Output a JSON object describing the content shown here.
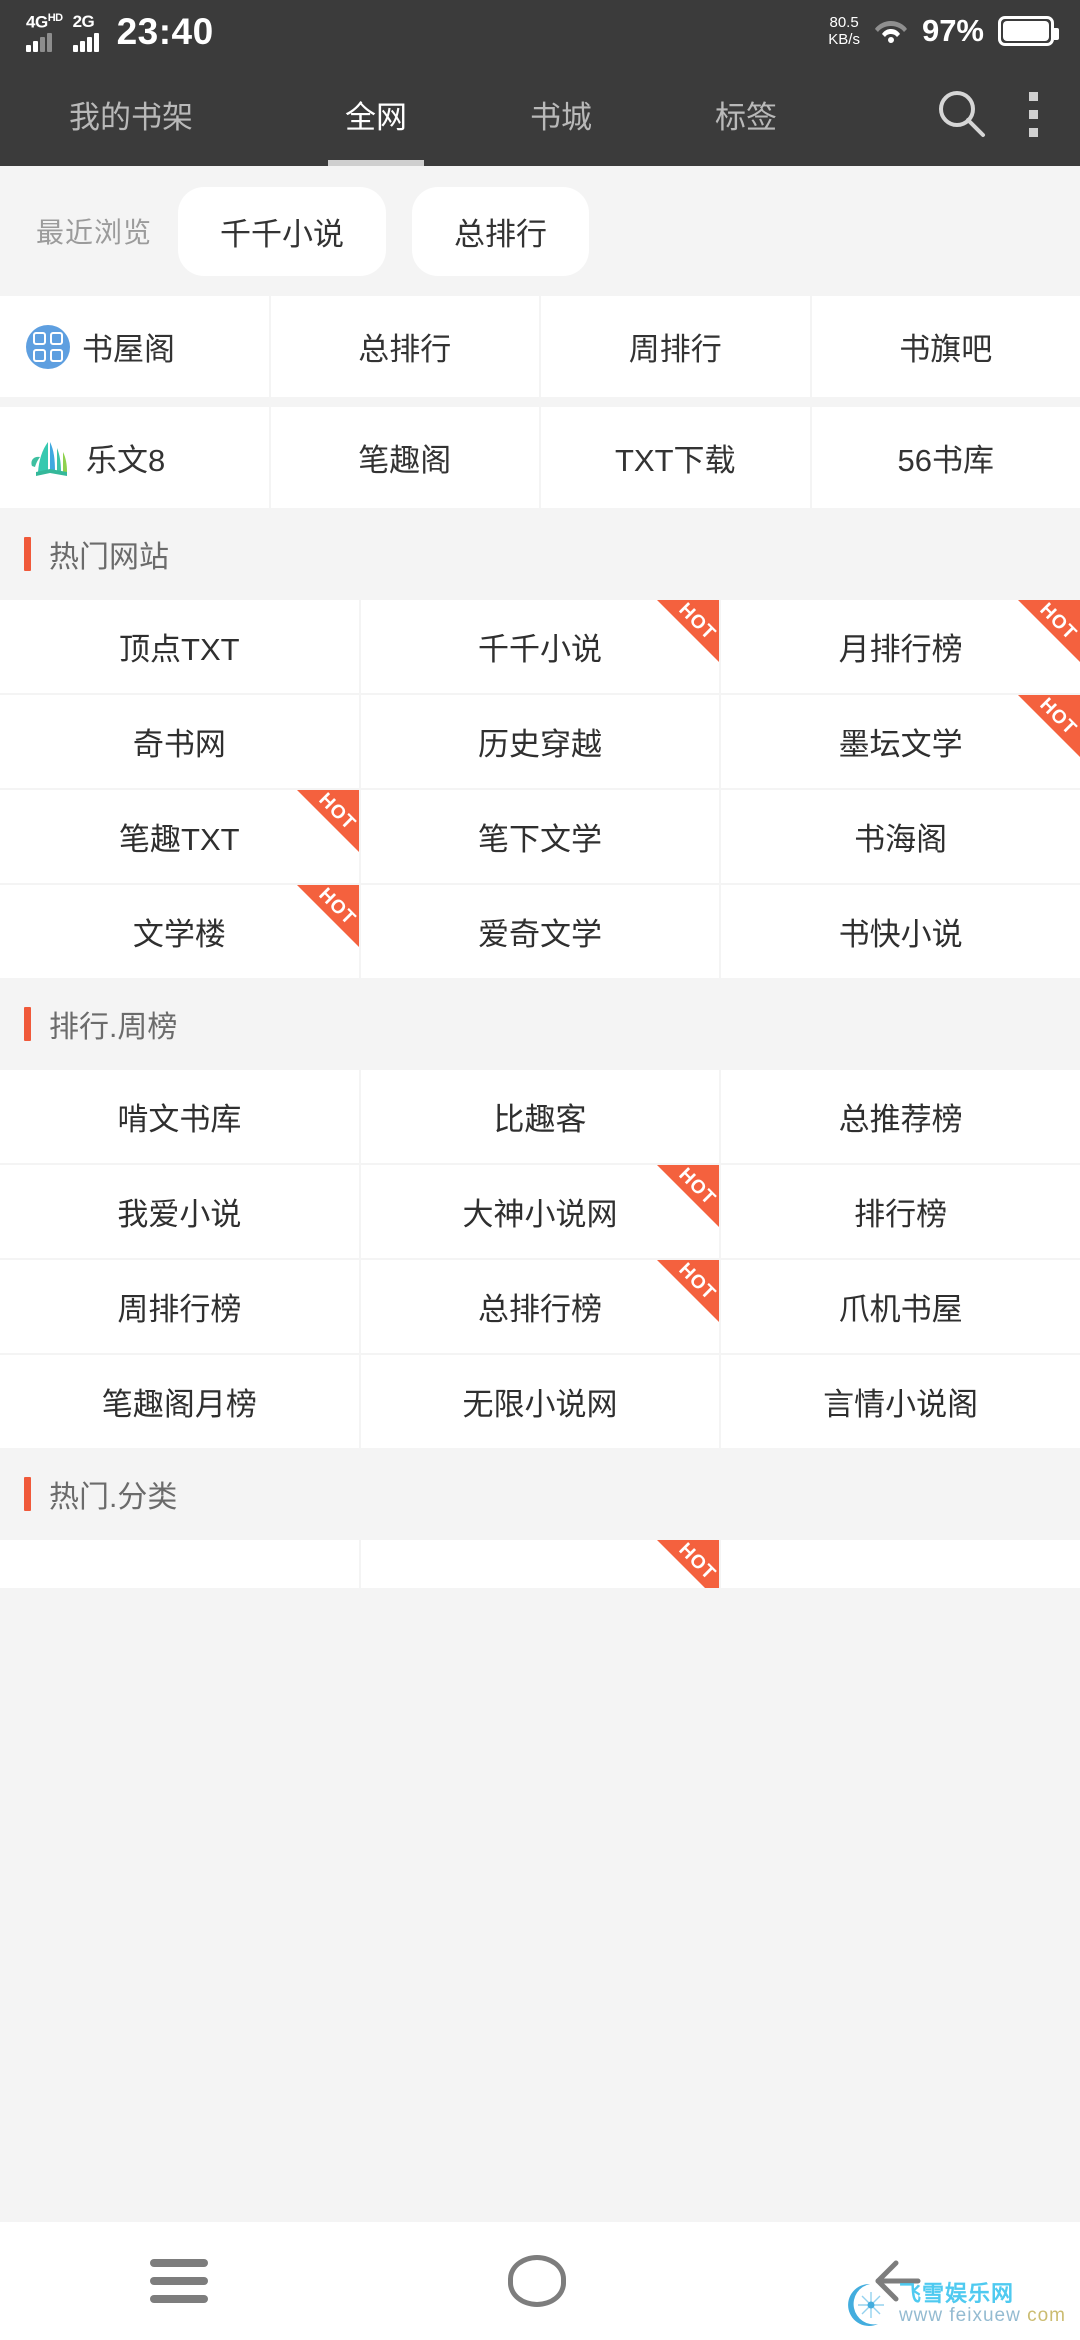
{
  "status_bar": {
    "signal_primary": "4G",
    "signal_primary_sup": "HD",
    "signal_secondary": "2G",
    "time": "23:40",
    "net_speed_value": "80.5",
    "net_speed_unit": "KB/s",
    "wifi_icon": "wifi-icon",
    "battery_percent": "97%"
  },
  "appbar": {
    "tabs": [
      {
        "label": "我的书架",
        "active": false
      },
      {
        "label": "全网",
        "active": true
      },
      {
        "label": "书城",
        "active": false
      },
      {
        "label": "标签",
        "active": false
      }
    ],
    "search_icon": "search-icon",
    "overflow_icon": "more-vertical-icon"
  },
  "recent": {
    "label": "最近浏览",
    "items": [
      "千千小说",
      "总排行"
    ]
  },
  "quick_grid": [
    [
      {
        "label": "书屋阁",
        "icon": "grid-app-icon"
      },
      {
        "label": "总排行",
        "icon": null
      },
      {
        "label": "周排行",
        "icon": null
      },
      {
        "label": "书旗吧",
        "icon": null
      }
    ],
    [
      {
        "label": "乐文8",
        "icon": "open-book-icon"
      },
      {
        "label": "笔趣阁",
        "icon": null
      },
      {
        "label": "TXT下载",
        "icon": null
      },
      {
        "label": "56书库",
        "icon": null
      }
    ]
  ],
  "sections": [
    {
      "title": "热门网站",
      "rows": [
        [
          {
            "label": "顶点TXT",
            "hot": false
          },
          {
            "label": "千千小说",
            "hot": true
          },
          {
            "label": "月排行榜",
            "hot": true
          }
        ],
        [
          {
            "label": "奇书网",
            "hot": false
          },
          {
            "label": "历史穿越",
            "hot": false
          },
          {
            "label": "墨坛文学",
            "hot": true
          }
        ],
        [
          {
            "label": "笔趣TXT",
            "hot": true
          },
          {
            "label": "笔下文学",
            "hot": false
          },
          {
            "label": "书海阁",
            "hot": false
          }
        ],
        [
          {
            "label": "文学楼",
            "hot": true
          },
          {
            "label": "爱奇文学",
            "hot": false
          },
          {
            "label": "书快小说",
            "hot": false
          }
        ]
      ]
    },
    {
      "title": "排行.周榜",
      "rows": [
        [
          {
            "label": "啃文书库",
            "hot": false
          },
          {
            "label": "比趣客",
            "hot": false
          },
          {
            "label": "总推荐榜",
            "hot": false
          }
        ],
        [
          {
            "label": "我爱小说",
            "hot": false
          },
          {
            "label": "大神小说网",
            "hot": true
          },
          {
            "label": "排行榜",
            "hot": false
          }
        ],
        [
          {
            "label": "周排行榜",
            "hot": false
          },
          {
            "label": "总排行榜",
            "hot": true
          },
          {
            "label": "爪机书屋",
            "hot": false
          }
        ],
        [
          {
            "label": "笔趣阁月榜",
            "hot": false
          },
          {
            "label": "无限小说网",
            "hot": false
          },
          {
            "label": "言情小说阁",
            "hot": false
          }
        ]
      ]
    },
    {
      "title": "热门.分类",
      "rows": [
        [
          {
            "label": "",
            "hot": false
          },
          {
            "label": "",
            "hot": true
          },
          {
            "label": "",
            "hot": false
          }
        ]
      ]
    }
  ],
  "hot_badge_text": "HOT",
  "navbar": {
    "recents_icon": "menu-recents-icon",
    "home_icon": "home-circle-icon",
    "back_icon": "back-arrow-icon"
  },
  "watermark": {
    "site_name": "飞雪娱乐网",
    "url_prefix": "www  feixuew",
    "url_domain": "com",
    "logo_icon": "snowflake-moon-icon"
  },
  "colors": {
    "accent_orange": "#f0593a",
    "appbar_bg": "#3b3b3b",
    "page_bg": "#f4f4f4",
    "tile_bg": "#ffffff",
    "brand_blue": "#5e9fe0",
    "brand_teal": "#3dbfa0"
  }
}
